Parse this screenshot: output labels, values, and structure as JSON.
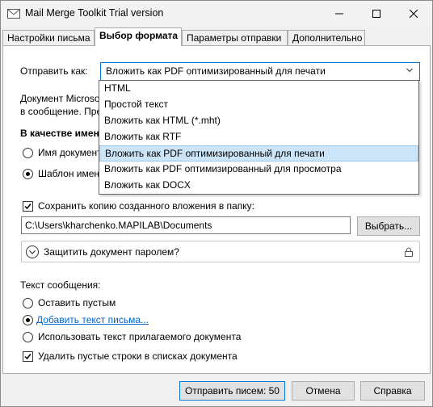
{
  "window": {
    "title": "Mail Merge Toolkit Trial version"
  },
  "tabs": [
    {
      "label": "Настройки письма"
    },
    {
      "label": "Выбор формата"
    },
    {
      "label": "Параметры отправки"
    },
    {
      "label": "Дополнительно"
    }
  ],
  "send_as": {
    "label": "Отправить как:",
    "value": "Вложить как PDF оптимизированный для печати",
    "options": [
      "HTML",
      "Простой текст",
      "Вложить как HTML (*.mht)",
      "Вложить как RTF",
      "Вложить как PDF оптимизированный для печати",
      "Вложить как PDF оптимизированный для просмотра",
      "Вложить как DOCX"
    ],
    "selected_index": 4
  },
  "description": {
    "line1": "Документ Microso",
    "line2": "в сообщение. Пре"
  },
  "name_as": {
    "heading": "В качестве имени",
    "option1": "Имя документ",
    "option2": "Шаблон имени"
  },
  "save_copy": {
    "label": "Сохранить копию созданного вложения в папку:",
    "checked": true,
    "path": "C:\\Users\\kharchenko.MAPILAB\\Documents",
    "browse_label": "Выбрать..."
  },
  "protect": {
    "label": "Защитить документ паролем?"
  },
  "message_text": {
    "heading": "Текст сообщения:",
    "option_empty": "Оставить пустым",
    "option_add_link": "Добавить текст письма...",
    "option_use_doc": "Использовать текст прилагаемого документа",
    "selected": "add"
  },
  "remove_empty": {
    "label": "Удалить пустые строки в списках документа",
    "checked": true
  },
  "footer": {
    "send_label": "Отправить писем: 50",
    "cancel_label": "Отмена",
    "help_label": "Справка"
  },
  "colors": {
    "accent": "#0078d4",
    "link": "#0066cc",
    "selection": "#cce4f7"
  }
}
